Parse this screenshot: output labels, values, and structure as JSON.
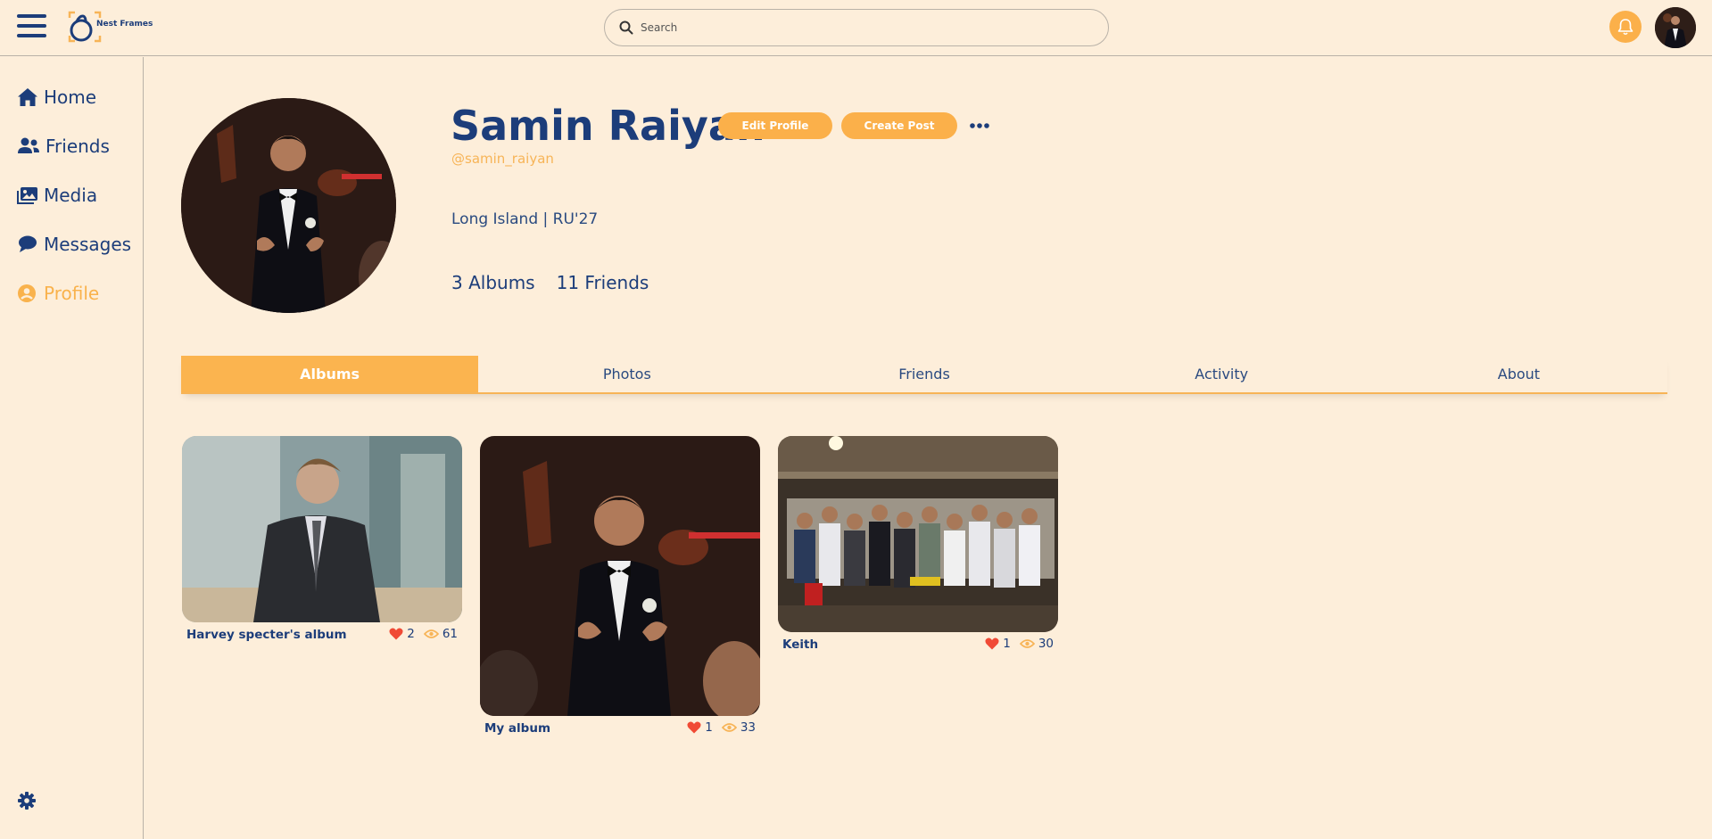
{
  "app": {
    "name": "Nest Frames"
  },
  "search": {
    "placeholder": "Search"
  },
  "sidebar": {
    "items": [
      {
        "label": "Home",
        "icon": "home-icon"
      },
      {
        "label": "Friends",
        "icon": "users-icon"
      },
      {
        "label": "Media",
        "icon": "images-icon"
      },
      {
        "label": "Messages",
        "icon": "chat-icon"
      },
      {
        "label": "Profile",
        "icon": "user-circle-icon"
      }
    ],
    "active": "Profile"
  },
  "profile": {
    "name": "Samin Raiyan",
    "handle": "@samin_raiyan",
    "bio": "Long Island | RU'27",
    "albums_stat": "3 Albums",
    "friends_stat": "11 Friends",
    "edit_button": "Edit Profile",
    "create_button": "Create Post"
  },
  "tabs": [
    "Albums",
    "Photos",
    "Friends",
    "Activity",
    "About"
  ],
  "active_tab": "Albums",
  "albums": [
    {
      "title": "Harvey specter's album",
      "likes": "2",
      "views": "61"
    },
    {
      "title": "My album",
      "likes": "1",
      "views": "33"
    },
    {
      "title": "Keith",
      "likes": "1",
      "views": "30"
    }
  ],
  "colors": {
    "background": "#fdeeda",
    "primary": "#1c3d7a",
    "accent": "#fbb04a",
    "heart": "#f04a35"
  }
}
